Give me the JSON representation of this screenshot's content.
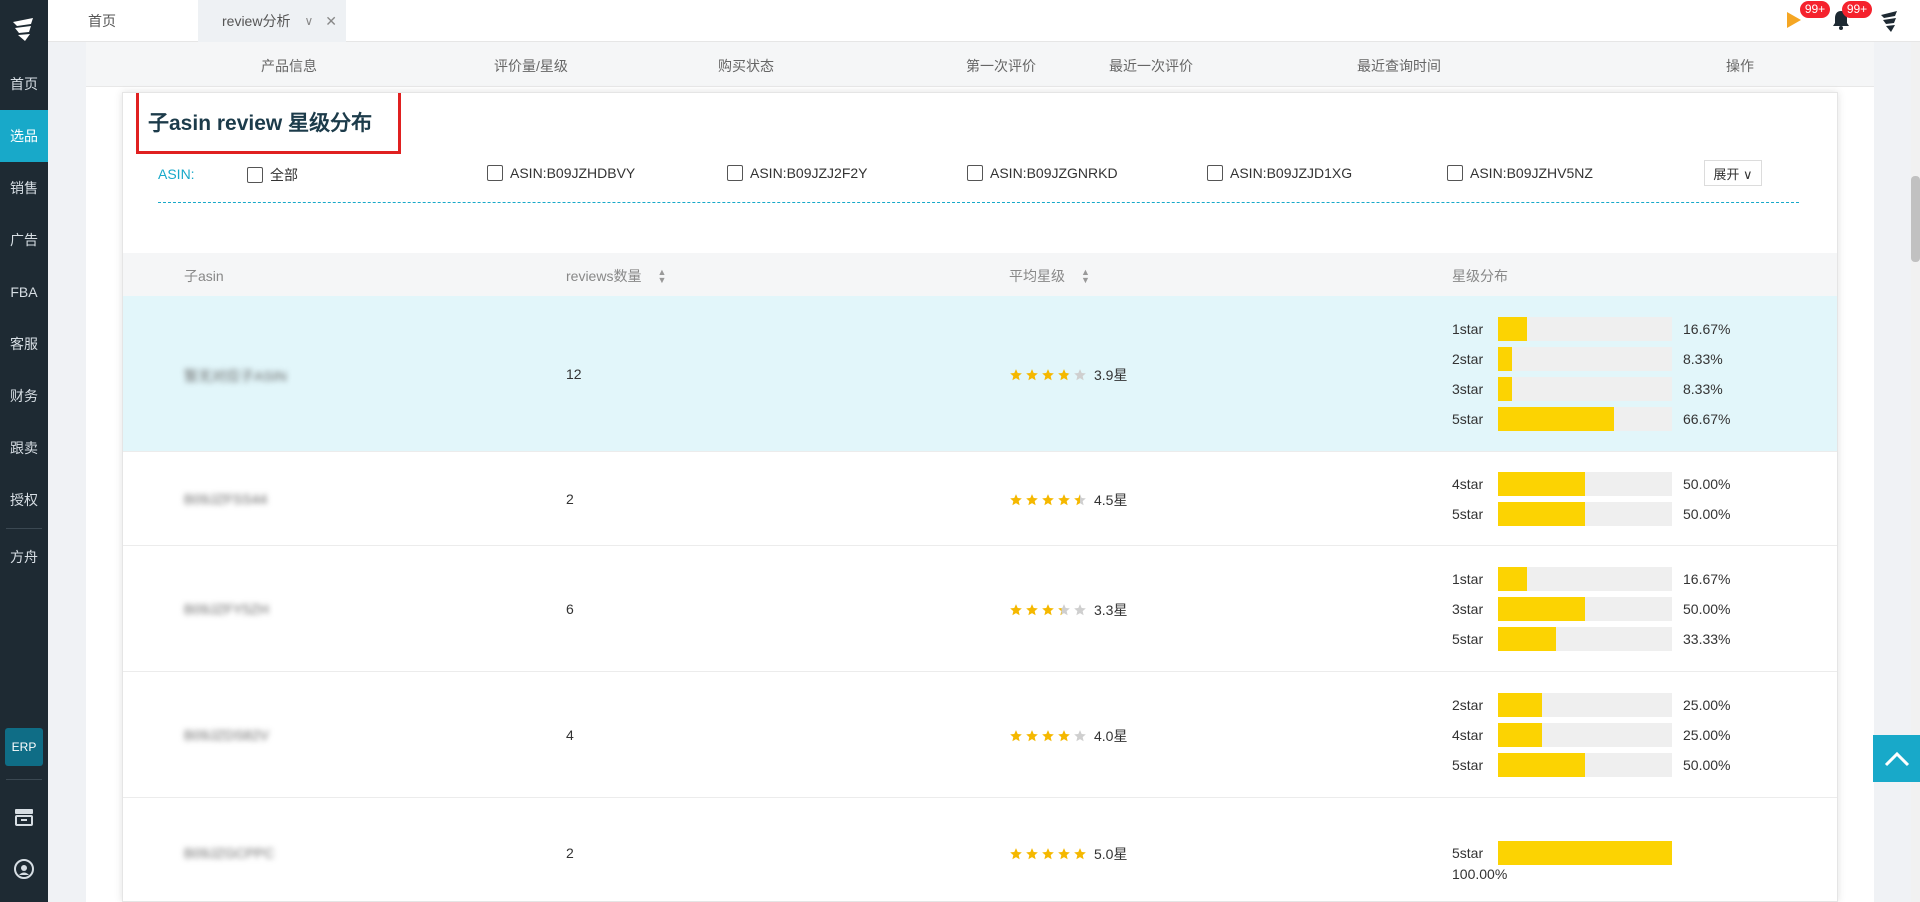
{
  "sidebar": {
    "logo": "logo-icon",
    "items": [
      {
        "label": "首页"
      },
      {
        "label": "选品"
      },
      {
        "label": "销售"
      },
      {
        "label": "广告"
      },
      {
        "label": "FBA"
      },
      {
        "label": "客服"
      },
      {
        "label": "财务"
      },
      {
        "label": "跟卖"
      },
      {
        "label": "授权"
      },
      {
        "label": "方舟"
      }
    ],
    "erp_label": "ERP",
    "active_color": "#18a9c9"
  },
  "tabs": {
    "home": "首页",
    "review": "review分析"
  },
  "notifications": {
    "flag_count": "99+",
    "bell_count": "99+"
  },
  "table_header": {
    "product_info": "产品信息",
    "review_count_star": "评价量/星级",
    "purchase_status": "购买状态",
    "first_review": "第一次评价",
    "latest_review": "最近一次评价",
    "latest_query": "最近查询时间",
    "actions": "操作"
  },
  "panel": {
    "title": "子asin review 星级分布",
    "asin_label": "ASIN:",
    "filters": [
      "全部",
      "ASIN:B09JZHDBVY",
      "ASIN:B09JZJ2F2Y",
      "ASIN:B09JZGNRKD",
      "ASIN:B09JZJD1XG",
      "ASIN:B09JZHV5NZ"
    ],
    "expand_label": "展开 ∨",
    "columns": {
      "child_asin": "子asin",
      "reviews": "reviews数量",
      "avg_star": "平均星级",
      "distribution": "星级分布"
    },
    "rows": [
      {
        "asin": "暂无对应子ASIN",
        "reviews": "12",
        "rating": 3.9,
        "rating_text": "3.9星",
        "dist": [
          {
            "label": "1star",
            "value": 16.67,
            "pct": "16.67%"
          },
          {
            "label": "2star",
            "value": 8.33,
            "pct": "8.33%"
          },
          {
            "label": "3star",
            "value": 8.33,
            "pct": "8.33%"
          },
          {
            "label": "5star",
            "value": 66.67,
            "pct": "66.67%"
          }
        ]
      },
      {
        "asin": "B09JZFSS44",
        "reviews": "2",
        "rating": 4.5,
        "rating_text": "4.5星",
        "dist": [
          {
            "label": "4star",
            "value": 50,
            "pct": "50.00%"
          },
          {
            "label": "5star",
            "value": 50,
            "pct": "50.00%"
          }
        ]
      },
      {
        "asin": "B09JZFY5ZH",
        "reviews": "6",
        "rating": 3.3,
        "rating_text": "3.3星",
        "dist": [
          {
            "label": "1star",
            "value": 16.67,
            "pct": "16.67%"
          },
          {
            "label": "3star",
            "value": 50,
            "pct": "50.00%"
          },
          {
            "label": "5star",
            "value": 33.33,
            "pct": "33.33%"
          }
        ]
      },
      {
        "asin": "B09JZDS82V",
        "reviews": "4",
        "rating": 4.0,
        "rating_text": "4.0星",
        "dist": [
          {
            "label": "2star",
            "value": 25,
            "pct": "25.00%"
          },
          {
            "label": "4star",
            "value": 25,
            "pct": "25.00%"
          },
          {
            "label": "5star",
            "value": 50,
            "pct": "50.00%"
          }
        ]
      },
      {
        "asin": "B09JZGCPPC",
        "reviews": "2",
        "rating": 5.0,
        "rating_text": "5.0星",
        "dist": [
          {
            "label": "5star",
            "value": 100,
            "pct": "100.00%"
          }
        ]
      }
    ]
  },
  "colors": {
    "accent": "#18a9c9",
    "bar_fill": "#fcd302",
    "highlight_row": "#e2f6fa",
    "title_border": "#e02020"
  }
}
